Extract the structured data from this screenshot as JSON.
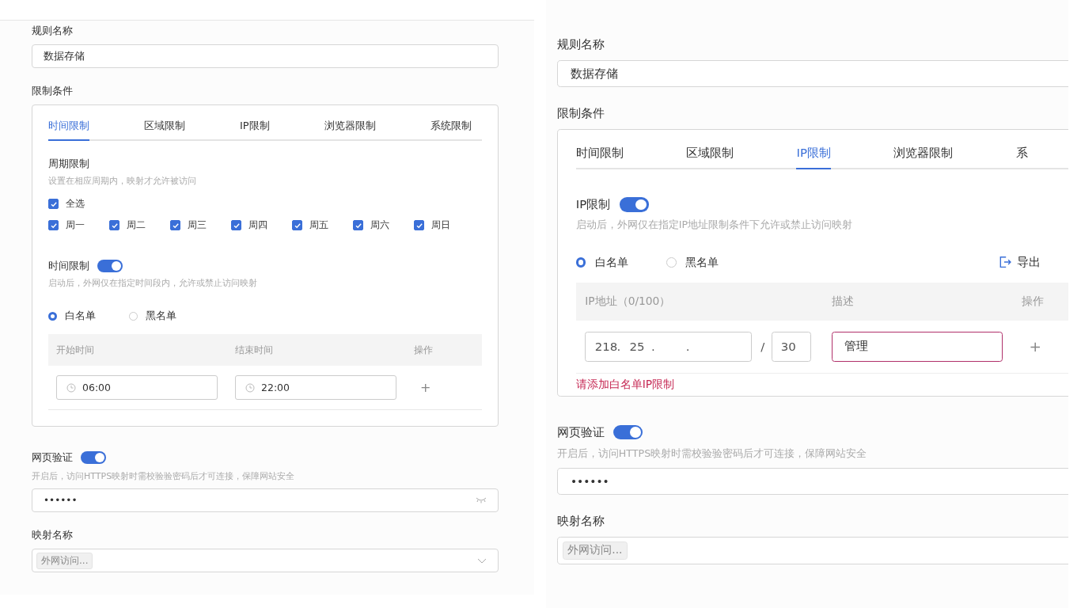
{
  "panels": [
    {
      "cut_at_right": false,
      "rule_label": "规则名称",
      "rule_value": "数据存储",
      "conditions_label": "限制条件",
      "tabs": [
        {
          "label": "时间限制",
          "selected": true
        },
        {
          "label": "区域限制",
          "selected": false
        },
        {
          "label": "IP限制",
          "selected": false
        },
        {
          "label": "浏览器限制",
          "selected": false
        },
        {
          "label": "系统限制",
          "selected": false
        }
      ],
      "content": {
        "kind": "time",
        "period_title": "周期限制",
        "period_hint": "设置在相应周期内，映射才允许被访问",
        "select_all": {
          "label": "全选",
          "checked": true
        },
        "days": [
          {
            "label": "周一",
            "checked": true
          },
          {
            "label": "周二",
            "checked": true
          },
          {
            "label": "周三",
            "checked": true
          },
          {
            "label": "周四",
            "checked": true
          },
          {
            "label": "周五",
            "checked": true
          },
          {
            "label": "周六",
            "checked": true
          },
          {
            "label": "周日",
            "checked": true
          }
        ],
        "toggle": {
          "label": "时间限制",
          "on": true
        },
        "toggle_hint": "启动后，外网仅在指定时间段内，允许或禁止访问映射",
        "modes": [
          {
            "label": "白名单",
            "selected": true
          },
          {
            "label": "黑名单",
            "selected": false
          }
        ],
        "columns": [
          "开始时间",
          "结束时间",
          "操作"
        ],
        "rows": [
          {
            "start": "06:00",
            "end": "22:00",
            "action": "+"
          }
        ]
      },
      "web_auth": {
        "label": "网页验证",
        "on": true,
        "hint": "开启后，访问HTTPS映射时需校验验密码后才可连接，保障网站安全",
        "password": "••••••"
      },
      "mapping": {
        "label": "映射名称",
        "tag": "外网访问..."
      }
    },
    {
      "cut_at_right": true,
      "rule_label": "规则名称",
      "rule_value": "数据存储",
      "conditions_label": "限制条件",
      "tabs": [
        {
          "label": "时间限制",
          "selected": false
        },
        {
          "label": "区域限制",
          "selected": false
        },
        {
          "label": "IP限制",
          "selected": true
        },
        {
          "label": "浏览器限制",
          "selected": false
        },
        {
          "label": "系",
          "selected": false
        }
      ],
      "content": {
        "kind": "ip",
        "toggle": {
          "label": "IP限制",
          "on": true
        },
        "toggle_hint": "启动后，外网仅在指定IP地址限制条件下允许或禁止访问映射",
        "modes": [
          {
            "label": "白名单",
            "selected": true
          },
          {
            "label": "黑名单",
            "selected": false
          }
        ],
        "export": "导出",
        "columns": [
          "IP地址（0/100）",
          "描述",
          "操作"
        ],
        "rows": [
          {
            "octets": [
              "218",
              "25"
            ],
            "separator": ".",
            "slash": "/",
            "prefix": "30",
            "description": "管理",
            "error": true,
            "action": "+"
          }
        ],
        "error_text": "请添加白名单IP限制"
      },
      "web_auth": {
        "label": "网页验证",
        "on": true,
        "hint": "开启后，访问HTTPS映射时需校验验密码后才可连接，保障网站安全",
        "password": "••••••"
      },
      "mapping": {
        "label": "映射名称",
        "tag": "外网访问..."
      }
    }
  ]
}
